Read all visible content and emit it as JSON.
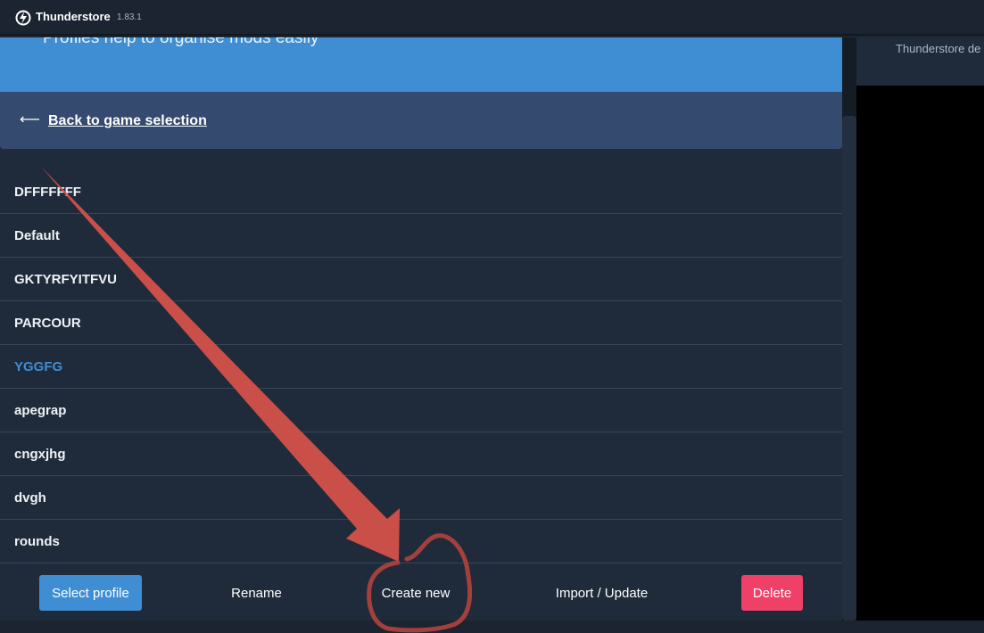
{
  "app": {
    "name": "Thunderstore",
    "version": "1.83.1"
  },
  "hero": {
    "subtitle": "Profiles help to organise mods easily"
  },
  "nav": {
    "back_arrow": "⟵",
    "back_label": "Back to game selection"
  },
  "profiles": [
    {
      "name": "DFFFFFFF",
      "selected": false
    },
    {
      "name": "Default",
      "selected": false
    },
    {
      "name": "GKTYRFYITFVU",
      "selected": false
    },
    {
      "name": "PARCOUR",
      "selected": false
    },
    {
      "name": "YGGFG",
      "selected": true
    },
    {
      "name": "apegrap",
      "selected": false
    },
    {
      "name": "cngxjhg",
      "selected": false
    },
    {
      "name": "dvgh",
      "selected": false
    },
    {
      "name": "rounds",
      "selected": false
    }
  ],
  "actions": {
    "select": "Select profile",
    "rename": "Rename",
    "create": "Create new",
    "import": "Import / Update",
    "delete": "Delete"
  },
  "side_panel": {
    "text": "Thunderstore de"
  },
  "colors": {
    "accent": "#3f8ed3",
    "danger": "#ef4068",
    "annotation": "#d9534a"
  }
}
